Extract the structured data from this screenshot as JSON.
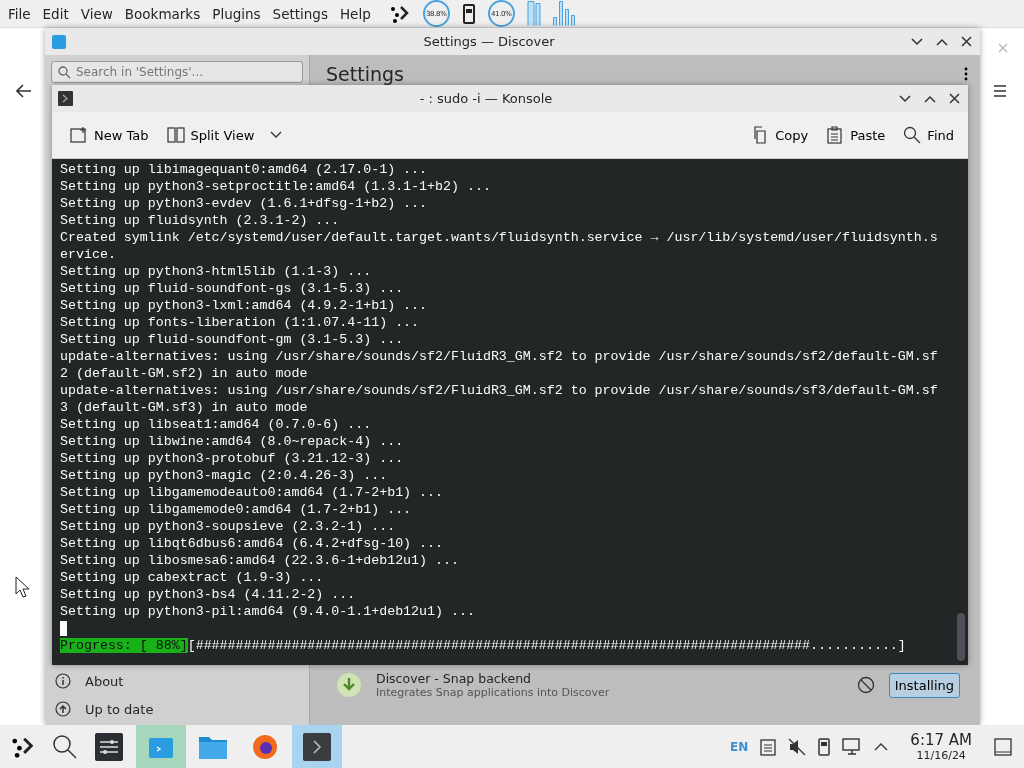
{
  "menu_bar": {
    "items": [
      "File",
      "Edit",
      "View",
      "Bookmarks",
      "Plugins",
      "Settings",
      "Help"
    ],
    "gauges": [
      "38.8%",
      "41.0%"
    ]
  },
  "discover": {
    "title": "Settings — Discover",
    "search": {
      "placeholder": "Search in 'Settings'..."
    },
    "heading": "Settings",
    "sidebar_items": [
      {
        "label": "About",
        "kind": "info"
      },
      {
        "label": "Up to date",
        "kind": "update"
      }
    ],
    "backend": {
      "name": "Discover - Snap backend",
      "description": "Integrates Snap applications into Discover",
      "button": "Installing"
    }
  },
  "konsole": {
    "title": "- : sudo -i — Konsole",
    "toolbar_left": [
      {
        "label": "New Tab",
        "kind": "newtab"
      },
      {
        "label": "Split View",
        "kind": "split"
      }
    ],
    "toolbar_right": [
      {
        "label": "Copy",
        "kind": "copy"
      },
      {
        "label": "Paste",
        "kind": "paste"
      },
      {
        "label": "Find",
        "kind": "find"
      }
    ],
    "lines": [
      "Setting up libimagequant0:amd64 (2.17.0-1) ...",
      "Setting up python3-setproctitle:amd64 (1.3.1-1+b2) ...",
      "Setting up python3-evdev (1.6.1+dfsg-1+b2) ...",
      "Setting up fluidsynth (2.3.1-2) ...",
      "Created symlink /etc/systemd/user/default.target.wants/fluidsynth.service → /usr/lib/systemd/user/fluidsynth.s",
      "ervice.",
      "Setting up python3-html5lib (1.1-3) ...",
      "Setting up fluid-soundfont-gs (3.1-5.3) ...",
      "Setting up python3-lxml:amd64 (4.9.2-1+b1) ...",
      "Setting up fonts-liberation (1:1.07.4-11) ...",
      "Setting up fluid-soundfont-gm (3.1-5.3) ...",
      "update-alternatives: using /usr/share/sounds/sf2/FluidR3_GM.sf2 to provide /usr/share/sounds/sf2/default-GM.sf",
      "2 (default-GM.sf2) in auto mode",
      "update-alternatives: using /usr/share/sounds/sf2/FluidR3_GM.sf2 to provide /usr/share/sounds/sf3/default-GM.sf",
      "3 (default-GM.sf3) in auto mode",
      "Setting up libseat1:amd64 (0.7.0-6) ...",
      "Setting up libwine:amd64 (8.0~repack-4) ...",
      "Setting up python3-protobuf (3.21.12-3) ...",
      "Setting up python3-magic (2:0.4.26-3) ...",
      "Setting up libgamemodeauto0:amd64 (1.7-2+b1) ...",
      "Setting up libgamemode0:amd64 (1.7-2+b1) ...",
      "Setting up python3-soupsieve (2.3.2-1) ...",
      "Setting up libqt6dbus6:amd64 (6.4.2+dfsg-10) ...",
      "Setting up libosmesa6:amd64 (22.3.6-1+deb12u1) ...",
      "Setting up cabextract (1.9-3) ...",
      "Setting up python3-bs4 (4.11.2-2) ...",
      "Setting up python3-pil:amd64 (9.4.0-1.1+deb12u1) ..."
    ],
    "progress": {
      "label": "Progress: [ 88%]",
      "bar": "[#############################################################################...........]"
    }
  },
  "taskbar": {
    "apps": [
      {
        "kind": "settings",
        "selected": false
      },
      {
        "kind": "discover",
        "selected": true
      },
      {
        "kind": "files",
        "selected": false
      },
      {
        "kind": "browser",
        "selected": false
      },
      {
        "kind": "terminal",
        "selected": true
      }
    ],
    "language": "EN",
    "time": "6:17 AM",
    "date": "11/16/24"
  }
}
